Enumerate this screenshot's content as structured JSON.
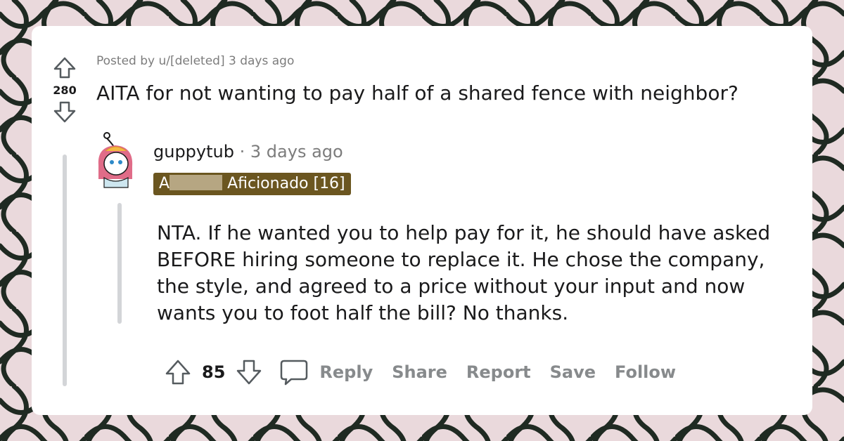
{
  "post": {
    "posted_by": "Posted by u/[deleted] 3 days ago",
    "score": "280",
    "title": "AITA for not wanting to pay half of a shared fence with neighbor?"
  },
  "comment": {
    "username": "guppytub",
    "separator": "·",
    "time": "3 days ago",
    "flair_prefix": "A",
    "flair_suffix": "Aficionado [16]",
    "body": "NTA. If he wanted you to help pay for it, he should have asked BEFORE hiring someone to replace it. He chose the company, the style, and agreed to a price without your input and now wants you to foot half the bill? No thanks.",
    "score": "85",
    "actions": {
      "reply": "Reply",
      "share": "Share",
      "report": "Report",
      "save": "Save",
      "follow": "Follow"
    }
  },
  "icons": {
    "upvote": "upvote-arrow-icon",
    "downvote": "downvote-arrow-icon",
    "reply": "speech-bubble-icon",
    "avatar": "snoo-avatar"
  },
  "colors": {
    "flair_bg": "#6b5620",
    "muted_text": "#878a8c",
    "card_bg": "#ffffff",
    "background_lace": "#1f2a22"
  }
}
